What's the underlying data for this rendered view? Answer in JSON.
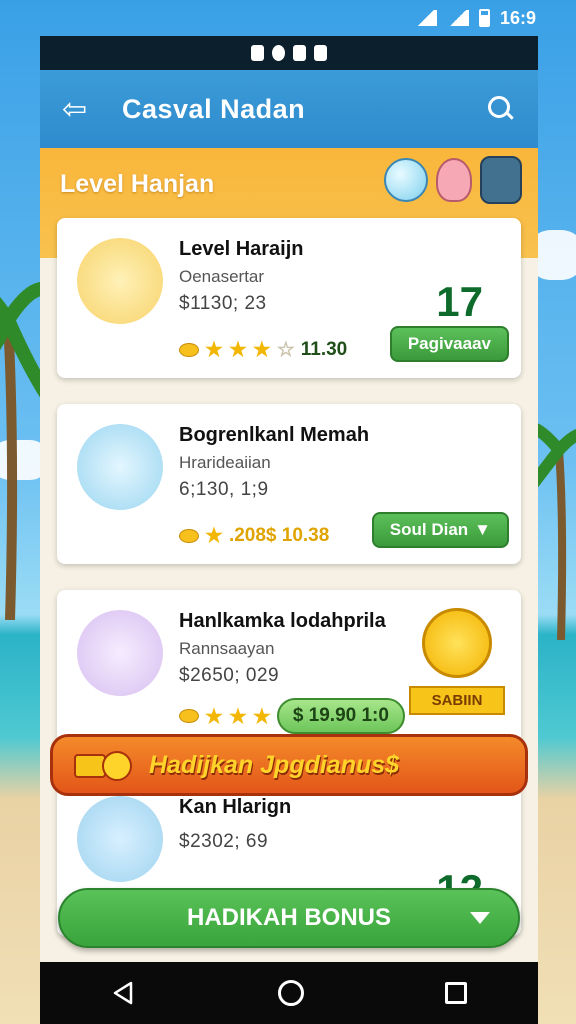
{
  "status": {
    "time": "16:9"
  },
  "appbar": {
    "title": "Casval Nadan"
  },
  "level_header": {
    "title": "Level Hanjan"
  },
  "cards": [
    {
      "name": "Level Haraijn",
      "sub": "Oenasertar",
      "price": "$1130; 23",
      "rating": "11.30",
      "count": "17",
      "button": "Pagivaaav",
      "stars_filled": 3,
      "stars_total": 4
    },
    {
      "name": "Bogrenlkanl Memah",
      "sub": "Hrarideaiian",
      "price": "6;130, 1;9",
      "rating": ".208$ 10.38",
      "button": "Soul Dian",
      "stars_filled": 1,
      "stars_total": 1
    },
    {
      "name": "Hanlkamka lodahprila",
      "sub": "Rannsaayan",
      "price": "$2650; 029",
      "rating": "$ 19.90 1:0",
      "badge": "SABIIN",
      "stars_filled": 3,
      "stars_total": 3
    },
    {
      "name": "Kan Hlarign",
      "sub": "",
      "price": "$2302; 69",
      "count": "12"
    }
  ],
  "banner": {
    "text": "Hadijkan Jpgdianus$"
  },
  "bonus_button": {
    "label": "HADIKAH BONUS"
  },
  "colors": {
    "primary": "#3b9bd8",
    "accent": "#f9b63b",
    "success": "#4caf50",
    "banner": "#e35619"
  }
}
